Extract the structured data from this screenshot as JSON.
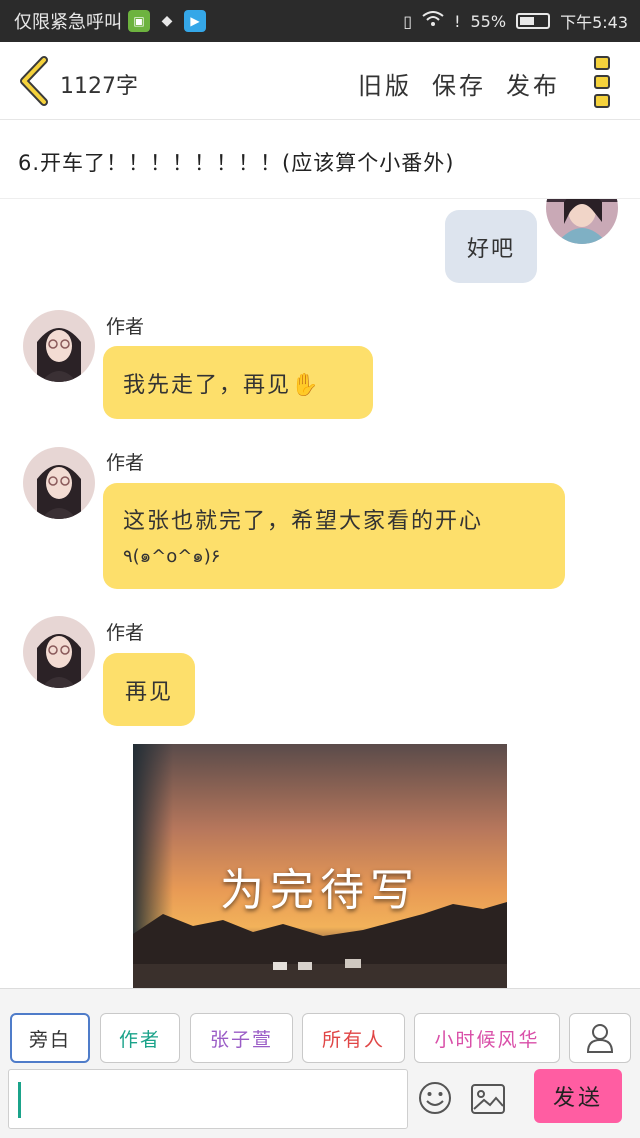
{
  "status_bar": {
    "carrier": "仅限紧急呼叫",
    "battery_text": "55%",
    "battery_level": 0.55,
    "time": "下午5:43"
  },
  "header": {
    "word_count": "1127字",
    "old_version": "旧版",
    "save": "保存",
    "publish": "发布"
  },
  "chapter": {
    "title": "6.开车了！！！！！！！！(应该算个小番外)"
  },
  "messages": [
    {
      "side": "right",
      "text": "好吧"
    },
    {
      "side": "left",
      "sender": "作者",
      "text": "我先走了，再见✋"
    },
    {
      "side": "left",
      "sender": "作者",
      "text_line1": "这张也就完了，希望大家看的开心",
      "text_line2": "٩(๑^o^๑)۶"
    },
    {
      "side": "left",
      "sender": "作者",
      "text": "再见"
    }
  ],
  "photo": {
    "caption": "为完待写"
  },
  "roles": [
    {
      "label": "旁白",
      "color": "#333333"
    },
    {
      "label": "作者",
      "color": "#1ba38a"
    },
    {
      "label": "张子萱",
      "color": "#9a5cc6"
    },
    {
      "label": "所有人",
      "color": "#e04646"
    },
    {
      "label": "小时候风华",
      "color": "#d94fa8"
    }
  ],
  "composer": {
    "input_value": "",
    "send_label": "发送"
  },
  "colors": {
    "author_bubble": "#fddf6b",
    "user_bubble": "#dde4ee",
    "send_button": "#ff5da2",
    "accent": "#f5d23c"
  }
}
